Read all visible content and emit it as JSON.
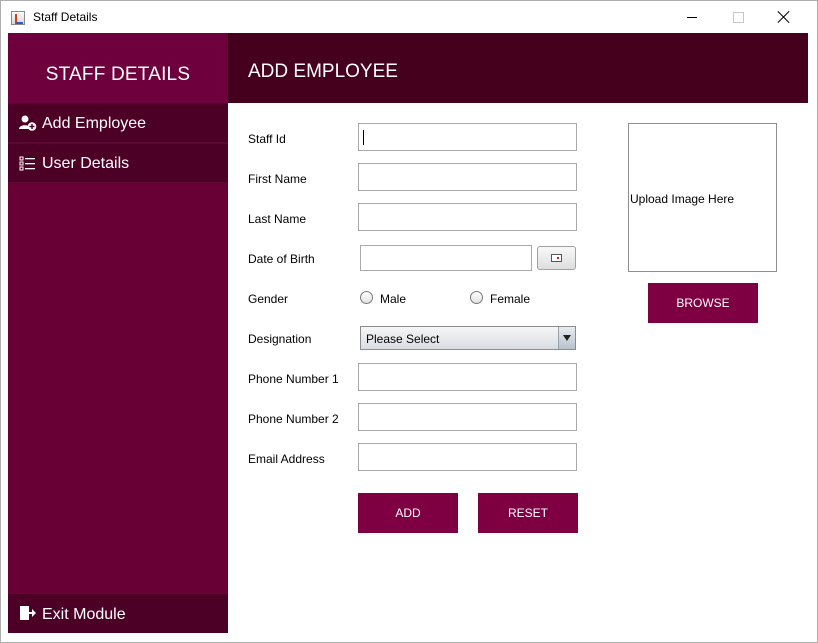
{
  "window": {
    "title": "Staff Details"
  },
  "sidebar": {
    "brand": "STAFF DETAILS",
    "items": [
      {
        "label": "Add Employee",
        "icon": "add-user-icon"
      },
      {
        "label": "User Details",
        "icon": "list-icon"
      }
    ],
    "exit": {
      "label": "Exit Module",
      "icon": "exit-icon"
    }
  },
  "header": {
    "title": "ADD EMPLOYEE"
  },
  "form": {
    "staff_id": {
      "label": "Staff Id",
      "value": ""
    },
    "first_name": {
      "label": "First Name",
      "value": ""
    },
    "last_name": {
      "label": "Last Name",
      "value": ""
    },
    "dob": {
      "label": "Date of Birth",
      "value": ""
    },
    "gender": {
      "label": "Gender",
      "options": [
        "Male",
        "Female"
      ]
    },
    "designation": {
      "label": "Designation",
      "selected": "Please Select"
    },
    "phone1": {
      "label": "Phone Number 1",
      "value": ""
    },
    "phone2": {
      "label": "Phone Number 2",
      "value": ""
    },
    "email": {
      "label": "Email Address",
      "value": ""
    },
    "add_label": "ADD",
    "reset_label": "RESET"
  },
  "image": {
    "placeholder": "Upload Image Here",
    "browse_label": "BROWSE"
  },
  "colors": {
    "sidebar": "#680036",
    "sidebar_item": "#4c0025",
    "header": "#45001e",
    "button": "#7e0042"
  }
}
